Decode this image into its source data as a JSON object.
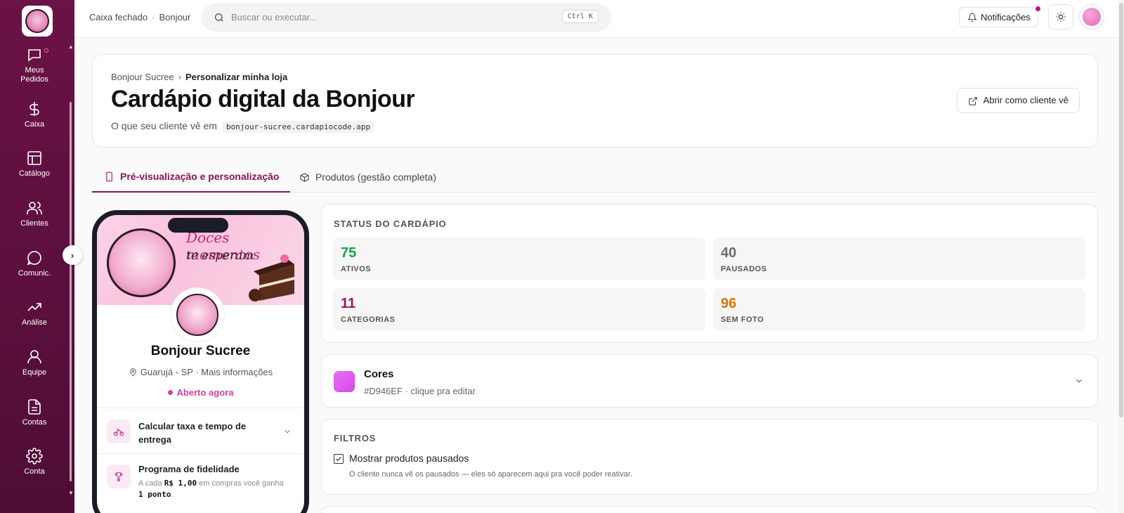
{
  "sidebar": {
    "items": [
      {
        "label": "Meus Pedidos",
        "icon": "chat-bubble-icon"
      },
      {
        "label": "Caixa",
        "icon": "dollar-icon"
      },
      {
        "label": "Catálogo",
        "icon": "layout-icon"
      },
      {
        "label": "Clientes",
        "icon": "users-icon"
      },
      {
        "label": "Comunic.",
        "icon": "message-circle-icon"
      },
      {
        "label": "Análise",
        "icon": "trending-up-icon"
      },
      {
        "label": "Equipe",
        "icon": "user-icon"
      },
      {
        "label": "Contas",
        "icon": "file-text-icon"
      },
      {
        "label": "Conta",
        "icon": "gear-icon"
      }
    ]
  },
  "topbar": {
    "store_status": "Caixa fechado",
    "store_name": "Bonjour",
    "search_placeholder": "Buscar ou executar...",
    "search_shortcut": "Ctrl K",
    "notifications_label": "Notificações"
  },
  "header": {
    "breadcrumb_root": "Bonjour Sucree",
    "breadcrumb_current": "Personalizar minha loja",
    "title": "Cardápio digital da Bonjour",
    "subtitle": "O que seu cliente vê em",
    "url": "bonjour-sucree.cardapiocode.app",
    "open_button": "Abrir como cliente vê"
  },
  "tabs": [
    {
      "label": "Pré-visualização e personalização",
      "active": true
    },
    {
      "label": "Produtos (gestão completa)",
      "active": false
    }
  ],
  "preview": {
    "banner_line1": "Doces momentos",
    "banner_line2": "te esperam",
    "store_name": "Bonjour Sucree",
    "location": "Guarujá - SP",
    "more_info": "Mais informações",
    "status": "Aberto agora",
    "delivery_title": "Calcular taxa e tempo de entrega",
    "loyalty_title": "Programa de fidelidade",
    "loyalty_pre": "A cada",
    "loyalty_amount": "R$ 1,00",
    "loyalty_mid": "em compras você ganha",
    "loyalty_points": "1 ponto",
    "loyalty_end": "."
  },
  "status_card": {
    "title": "STATUS DO CARDÁPIO",
    "stats": [
      {
        "value": "75",
        "label": "ATIVOS",
        "color": "#16a34a"
      },
      {
        "value": "40",
        "label": "PAUSADOS",
        "color": "#6b6b6b"
      },
      {
        "value": "11",
        "label": "CATEGORIAS",
        "color": "#a3135f"
      },
      {
        "value": "96",
        "label": "SEM FOTO",
        "color": "#d97706"
      }
    ]
  },
  "colors_card": {
    "title": "Cores",
    "subtitle": "#D946EF · clique pra editar",
    "swatch_color": "#D946EF"
  },
  "filters_card": {
    "title": "FILTROS",
    "checkbox_label": "Mostrar produtos pausados",
    "checked": true,
    "help": "O cliente nunca vê os pausados — eles só aparecem aqui pra você poder reativar."
  }
}
